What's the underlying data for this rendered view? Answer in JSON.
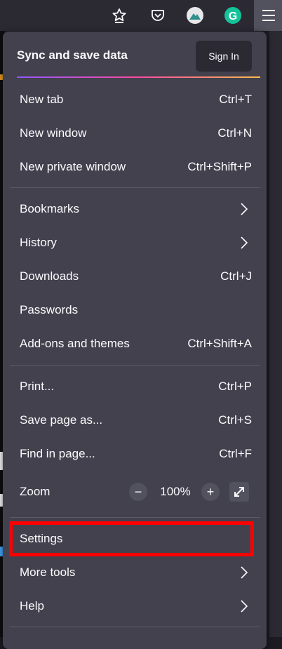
{
  "toolbar": {
    "icons": [
      "bookmark-star-icon",
      "pocket-icon",
      "vpn-icon",
      "grammarly-icon",
      "hamburger-menu-icon"
    ],
    "grammarly_letter": "G"
  },
  "menu": {
    "sync_title": "Sync and save data",
    "sign_in_label": "Sign In",
    "items": {
      "new_tab": {
        "label": "New tab",
        "shortcut": "Ctrl+T"
      },
      "new_window": {
        "label": "New window",
        "shortcut": "Ctrl+N"
      },
      "new_private_window": {
        "label": "New private window",
        "shortcut": "Ctrl+Shift+P"
      },
      "bookmarks": {
        "label": "Bookmarks"
      },
      "history": {
        "label": "History"
      },
      "downloads": {
        "label": "Downloads",
        "shortcut": "Ctrl+J"
      },
      "passwords": {
        "label": "Passwords"
      },
      "addons": {
        "label": "Add-ons and themes",
        "shortcut": "Ctrl+Shift+A"
      },
      "print": {
        "label": "Print...",
        "shortcut": "Ctrl+P"
      },
      "save_page": {
        "label": "Save page as...",
        "shortcut": "Ctrl+S"
      },
      "find": {
        "label": "Find in page...",
        "shortcut": "Ctrl+F"
      },
      "settings": {
        "label": "Settings"
      },
      "more_tools": {
        "label": "More tools"
      },
      "help": {
        "label": "Help"
      }
    },
    "zoom": {
      "label": "Zoom",
      "minus": "−",
      "value": "100%",
      "plus": "+"
    }
  },
  "colors": {
    "highlight": "#ff0000",
    "panel": "#42414d",
    "accent_gradient": [
      "#9059ff",
      "#ff4aa2",
      "#ffbd4f"
    ]
  }
}
